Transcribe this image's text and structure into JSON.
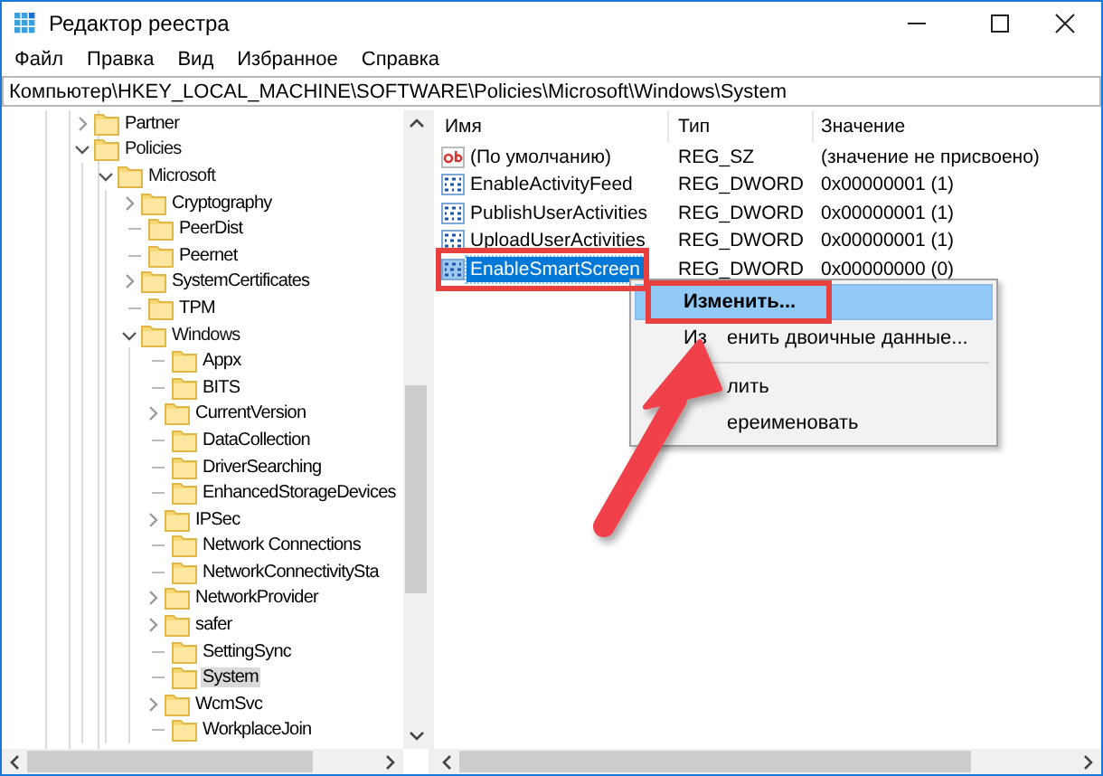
{
  "window": {
    "title": "Редактор реестра"
  },
  "menu": [
    "Файл",
    "Правка",
    "Вид",
    "Избранное",
    "Справка"
  ],
  "address": {
    "value": "Компьютер\\HKEY_LOCAL_MACHINE\\SOFTWARE\\Policies\\Microsoft\\Windows\\System"
  },
  "tree": [
    {
      "label": "Partner",
      "kind": "branch",
      "expanded": false,
      "selected": false
    },
    {
      "label": "Policies",
      "kind": "branch",
      "expanded": true,
      "selected": false,
      "children": [
        {
          "label": "Microsoft",
          "kind": "branch",
          "expanded": true,
          "selected": false,
          "children": [
            {
              "label": "Cryptography",
              "kind": "branch",
              "expanded": false,
              "selected": false
            },
            {
              "label": "PeerDist",
              "kind": "leaf",
              "selected": false
            },
            {
              "label": "Peernet",
              "kind": "leaf",
              "selected": false
            },
            {
              "label": "SystemCertificates",
              "kind": "branch",
              "expanded": false,
              "selected": false
            },
            {
              "label": "TPM",
              "kind": "leaf",
              "selected": false
            },
            {
              "label": "Windows",
              "kind": "branch",
              "expanded": true,
              "selected": false,
              "children": [
                {
                  "label": "Appx",
                  "kind": "leaf",
                  "selected": false
                },
                {
                  "label": "BITS",
                  "kind": "leaf",
                  "selected": false
                },
                {
                  "label": "CurrentVersion",
                  "kind": "branch",
                  "expanded": false,
                  "selected": false
                },
                {
                  "label": "DataCollection",
                  "kind": "leaf",
                  "selected": false
                },
                {
                  "label": "DriverSearching",
                  "kind": "leaf",
                  "selected": false
                },
                {
                  "label": "EnhancedStorageDevices",
                  "kind": "leaf",
                  "selected": false
                },
                {
                  "label": "IPSec",
                  "kind": "branch",
                  "expanded": false,
                  "selected": false
                },
                {
                  "label": "Network Connections",
                  "kind": "leaf",
                  "selected": false
                },
                {
                  "label": "NetworkConnectivitySta",
                  "kind": "leaf",
                  "selected": false
                },
                {
                  "label": "NetworkProvider",
                  "kind": "branch",
                  "expanded": false,
                  "selected": false
                },
                {
                  "label": "safer",
                  "kind": "branch",
                  "expanded": false,
                  "selected": false
                },
                {
                  "label": "SettingSync",
                  "kind": "leaf",
                  "selected": false
                },
                {
                  "label": "System",
                  "kind": "leaf",
                  "selected": true
                },
                {
                  "label": "WcmSvc",
                  "kind": "branch",
                  "expanded": false,
                  "selected": false
                },
                {
                  "label": "WorkplaceJoin",
                  "kind": "leaf",
                  "selected": false
                }
              ]
            }
          ]
        }
      ]
    }
  ],
  "values": {
    "columns": [
      "Имя",
      "Тип",
      "Значение"
    ],
    "rows": [
      {
        "kind": "string",
        "name": "(По умолчанию)",
        "type": "REG_SZ",
        "data": "(значение не присвоено)",
        "selected": false
      },
      {
        "kind": "dword",
        "name": "EnableActivityFeed",
        "type": "REG_DWORD",
        "data": "0x00000001 (1)",
        "selected": false
      },
      {
        "kind": "dword",
        "name": "PublishUserActivities",
        "type": "REG_DWORD",
        "data": "0x00000001 (1)",
        "selected": false
      },
      {
        "kind": "dword",
        "name": "UploadUserActivities",
        "type": "REG_DWORD",
        "data": "0x00000001 (1)",
        "selected": false
      },
      {
        "kind": "dword",
        "name": "EnableSmartScreen",
        "type": "REG_DWORD",
        "data": "0x00000000 (0)",
        "selected": true
      }
    ]
  },
  "context_menu": {
    "items": [
      {
        "kind": "item",
        "label": "Изменить...",
        "default": true,
        "selected": true
      },
      {
        "kind": "item",
        "label_start": "Из",
        "label_end": "енить двоичные данные...",
        "default": false,
        "selected": false
      },
      {
        "kind": "separator"
      },
      {
        "kind": "item",
        "label_end": "лить",
        "default": false,
        "selected": false
      },
      {
        "kind": "item",
        "label_end": "ереименовать",
        "default": false,
        "selected": false
      }
    ]
  }
}
